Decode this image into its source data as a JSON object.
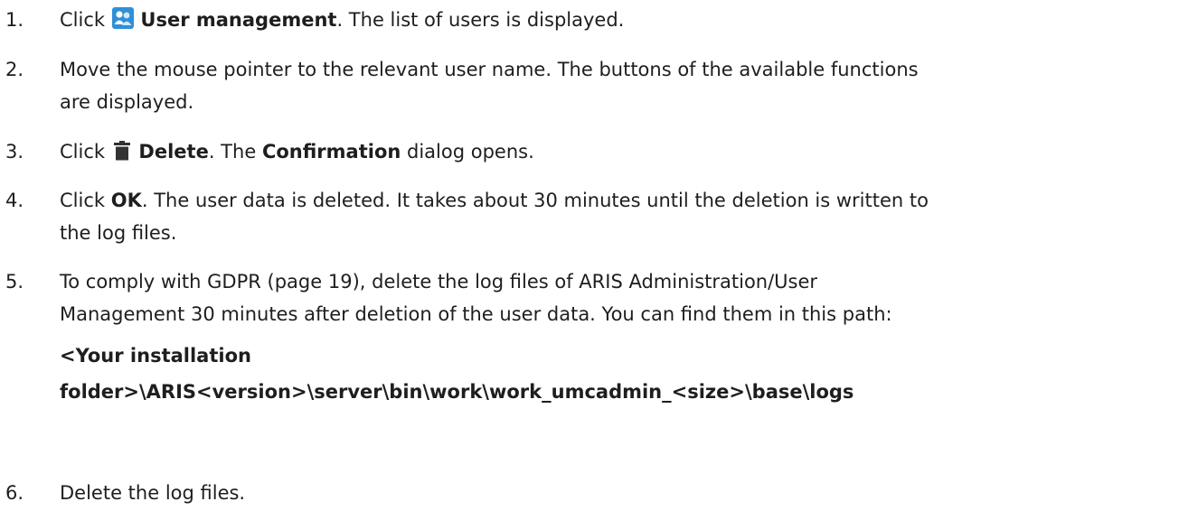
{
  "steps": [
    {
      "number": "1.",
      "pre": "Click",
      "bold": "User management",
      "post": ". The list of users is displayed.",
      "icon": "users-group-icon"
    },
    {
      "number": "2.",
      "line1": "Move the mouse pointer to the relevant user name. The buttons of the available functions",
      "line2": "are displayed."
    },
    {
      "number": "3.",
      "pre": "Click",
      "bold": "Delete",
      "mid": ". The",
      "bold2": "Confirmation",
      "post": "dialog opens.",
      "icon": "trash-icon"
    },
    {
      "number": "4.",
      "pre": "Click",
      "bold": "OK",
      "line1_rest": ". The user data is deleted. It takes about 30 minutes until the deletion is written to",
      "line2": "the log files."
    },
    {
      "number": "5.",
      "pre": "To comply with",
      "link": "GDPR (page 19)",
      "line1_rest": ", delete the log files of ARIS Administration/User",
      "line2": "Management 30 minutes after deletion of the user data. You can find them in this path:",
      "path_line1": "<Your installation",
      "path_line2": "folder>\\ARIS<version>\\server\\bin\\work\\work_umcadmin_<size>\\base\\logs"
    },
    {
      "number": "6.",
      "text": "Delete the log files."
    }
  ],
  "colors": {
    "text": "#1e1e1e",
    "icon_blue": "#2f8fd8",
    "icon_dark": "#333333"
  }
}
